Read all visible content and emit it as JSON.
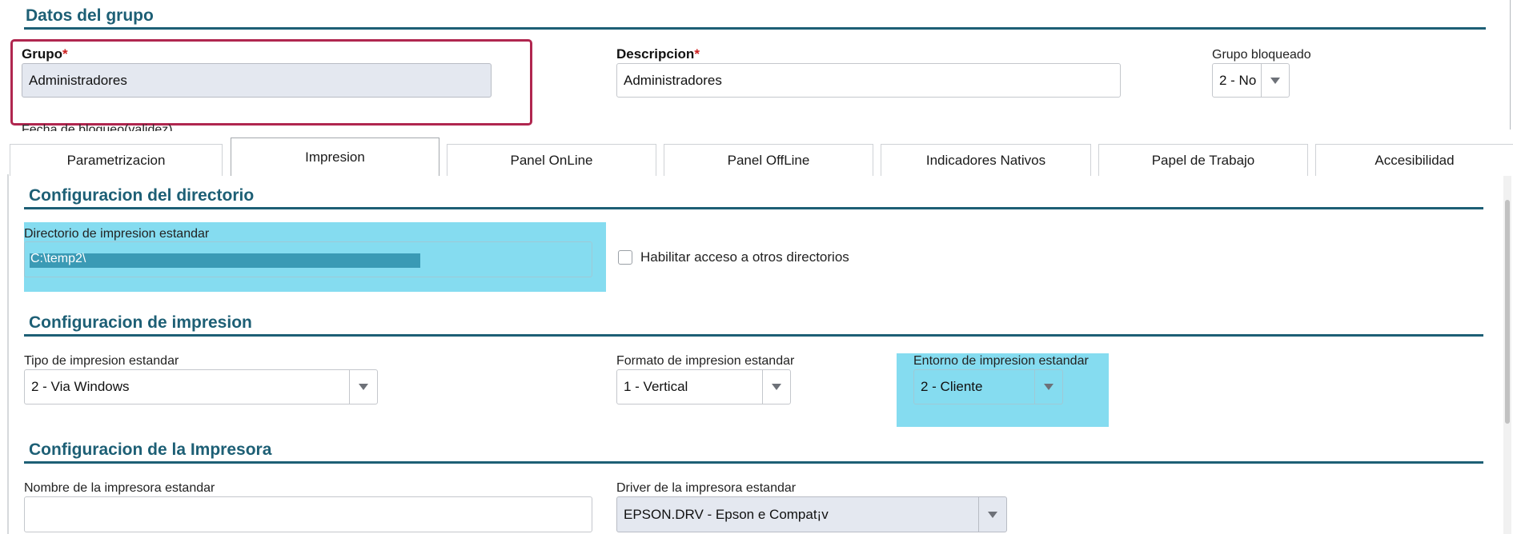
{
  "group_section": {
    "title": "Datos del grupo",
    "grupo": {
      "label": "Grupo",
      "required_mark": "*",
      "value": "Administradores"
    },
    "descripcion": {
      "label": "Descripcion",
      "required_mark": "*",
      "value": "Administradores"
    },
    "bloqueado": {
      "label": "Grupo bloqueado",
      "value": "2 - No"
    },
    "fecha_bloqueo_label": "Fecha de bloqueo(validez)"
  },
  "tabs": [
    {
      "label": "Parametrizacion"
    },
    {
      "label": "Impresion",
      "active": true
    },
    {
      "label": "Panel OnLine"
    },
    {
      "label": "Panel OffLine"
    },
    {
      "label": "Indicadores Nativos"
    },
    {
      "label": "Papel de Trabajo"
    },
    {
      "label": "Accesibilidad"
    }
  ],
  "directorio_section": {
    "title": "Configuracion del directorio",
    "dir_label": "Directorio de impresion estandar",
    "dir_value": "C:\\temp2\\",
    "checkbox_label": "Habilitar acceso a otros directorios",
    "checkbox_checked": false
  },
  "impresion_section": {
    "title": "Configuracion de impresion",
    "tipo": {
      "label": "Tipo de impresion estandar",
      "value": "2 - Via Windows"
    },
    "formato": {
      "label": "Formato de impresion estandar",
      "value": "1 - Vertical"
    },
    "entorno": {
      "label": "Entorno de impresion estandar",
      "value": "2 - Cliente"
    }
  },
  "impresora_section": {
    "title": "Configuracion de la Impresora",
    "nombre": {
      "label": "Nombre de la impresora estandar",
      "value": ""
    },
    "driver": {
      "label": "Driver de la impresora estandar",
      "value": "EPSON.DRV - Epson e Compat¡v"
    }
  },
  "colors": {
    "accent": "#1d5f75",
    "highlight": "#85dcf0",
    "focus_border": "#b0264f",
    "required": "#cc1e1e"
  }
}
